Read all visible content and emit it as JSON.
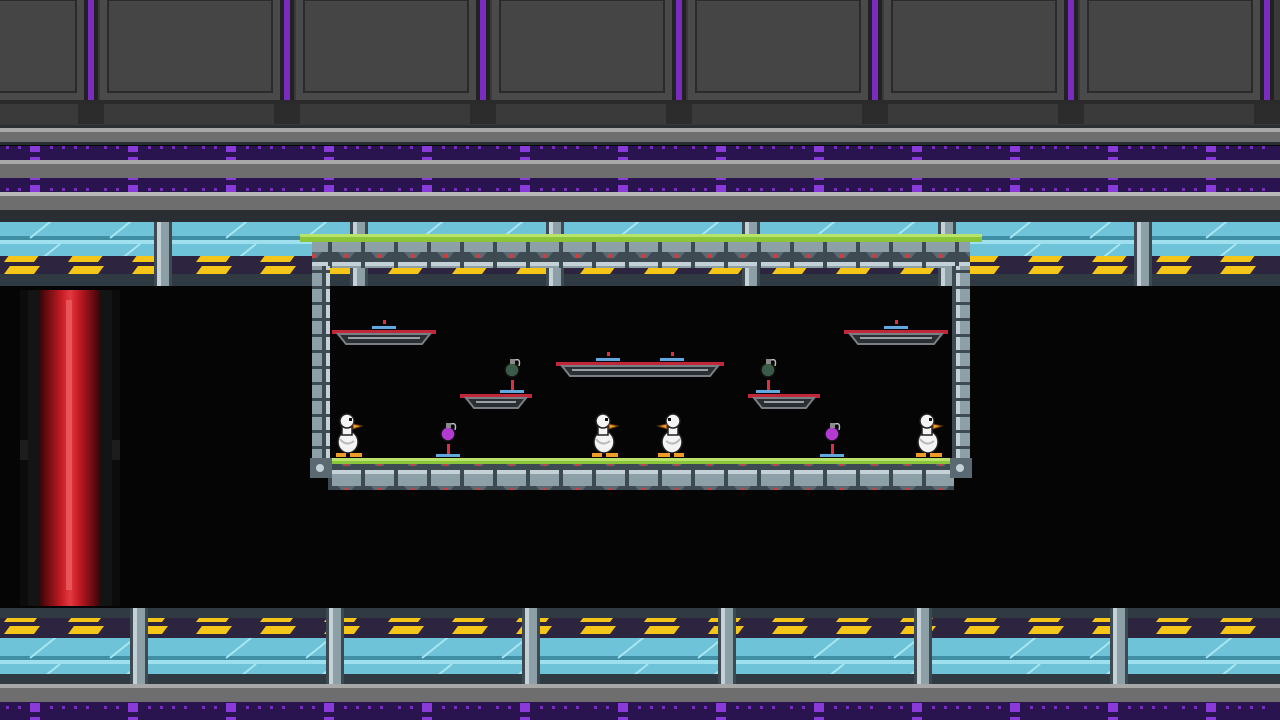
{
  "scene": {
    "title": "",
    "colors": {
      "wall_panel": "#4a4a4a",
      "wall_panel_dark": "#3a3a3a",
      "wall_seam": "#2a2a2a",
      "purple_accent": "#7a2bc0",
      "purple_dark": "#2a1450",
      "metal_light": "#a8a8a8",
      "metal_mid": "#6e6e6e",
      "glass_blue": "#6fc3d8",
      "glass_blue_dark": "#3f8ea3",
      "hazard_yellow": "#f5c518",
      "hazard_dark": "#2d2440",
      "arena_frame": "#8da0a8",
      "arena_frame_dark": "#3d4a52",
      "moss_green": "#8bc63a",
      "platform_red": "#c0283a",
      "platform_grey": "#7a7f86",
      "duck_white": "#f4f4f4",
      "duck_beak": "#f09a28",
      "grenade_green": "#3c5a48",
      "grenade_purple": "#b23ad0",
      "red_tube": "#c41a24"
    },
    "entities": {
      "ducks": [
        {
          "name": "duck-player-1"
        },
        {
          "name": "duck-player-2"
        },
        {
          "name": "duck-player-3"
        },
        {
          "name": "duck-player-4"
        }
      ],
      "pickups": [
        {
          "name": "grenade-green-left",
          "kind": "grenade-green-icon"
        },
        {
          "name": "grenade-green-right",
          "kind": "grenade-green-icon"
        },
        {
          "name": "grenade-purple-left",
          "kind": "grenade-purple-icon"
        },
        {
          "name": "grenade-purple-right",
          "kind": "grenade-purple-icon"
        }
      ]
    }
  }
}
